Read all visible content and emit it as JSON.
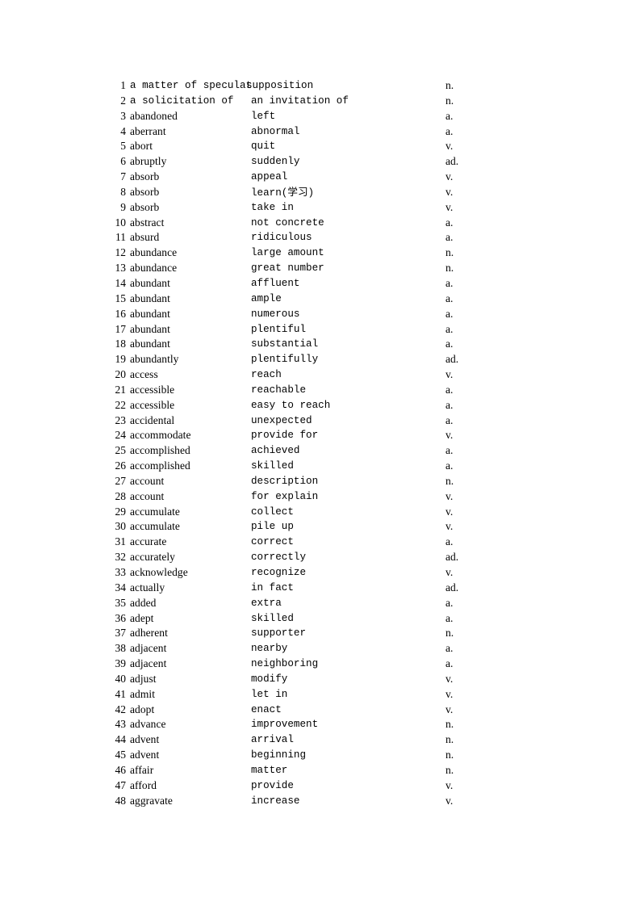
{
  "document": {
    "type": "vocabulary-synonym-list",
    "page_background": "#ffffff",
    "text_color": "#000000",
    "columns": {
      "index_header": "",
      "term_header": "",
      "definition_header": "",
      "pos_header": ""
    }
  },
  "rows": [
    {
      "index": "1",
      "term": "a matter of speculat",
      "definition": "supposition",
      "pos": "n.",
      "mono_term": false,
      "clipped": true
    },
    {
      "index": "2",
      "term": "a solicitation of",
      "definition": "an invitation of",
      "pos": "n.",
      "mono_term": true,
      "clipped": false
    },
    {
      "index": "3",
      "term": "abandoned",
      "definition": "left",
      "pos": "a.",
      "mono_term": false,
      "clipped": false
    },
    {
      "index": "4",
      "term": "aberrant",
      "definition": "abnormal",
      "pos": "a.",
      "mono_term": false,
      "clipped": false
    },
    {
      "index": "5",
      "term": "abort",
      "definition": "quit",
      "pos": "v.",
      "mono_term": false,
      "clipped": false
    },
    {
      "index": "6",
      "term": "abruptly",
      "definition": "suddenly",
      "pos": "ad.",
      "mono_term": false,
      "clipped": false
    },
    {
      "index": "7",
      "term": "absorb",
      "definition": "appeal",
      "pos": "v.",
      "mono_term": false,
      "clipped": false
    },
    {
      "index": "8",
      "term": "absorb",
      "definition": "learn(学习)",
      "pos": "v.",
      "mono_term": false,
      "clipped": false
    },
    {
      "index": "9",
      "term": "absorb",
      "definition": "take in",
      "pos": "v.",
      "mono_term": false,
      "clipped": false
    },
    {
      "index": "10",
      "term": "abstract",
      "definition": "not concrete",
      "pos": "a.",
      "mono_term": false,
      "clipped": false
    },
    {
      "index": "11",
      "term": "absurd",
      "definition": "ridiculous",
      "pos": "a.",
      "mono_term": false,
      "clipped": false
    },
    {
      "index": "12",
      "term": "abundance",
      "definition": "large amount",
      "pos": "n.",
      "mono_term": false,
      "clipped": false
    },
    {
      "index": "13",
      "term": "abundance",
      "definition": "great number",
      "pos": "n.",
      "mono_term": false,
      "clipped": false
    },
    {
      "index": "14",
      "term": "abundant",
      "definition": "affluent",
      "pos": "a.",
      "mono_term": false,
      "clipped": false
    },
    {
      "index": "15",
      "term": "abundant",
      "definition": "ample",
      "pos": "a.",
      "mono_term": false,
      "clipped": false
    },
    {
      "index": "16",
      "term": "abundant",
      "definition": "numerous",
      "pos": "a.",
      "mono_term": false,
      "clipped": false
    },
    {
      "index": "17",
      "term": "abundant",
      "definition": "plentiful",
      "pos": "a.",
      "mono_term": false,
      "clipped": false
    },
    {
      "index": "18",
      "term": "abundant",
      "definition": "substantial",
      "pos": "a.",
      "mono_term": false,
      "clipped": false
    },
    {
      "index": "19",
      "term": "abundantly",
      "definition": "plentifully",
      "pos": "ad.",
      "mono_term": false,
      "clipped": false
    },
    {
      "index": "20",
      "term": "access",
      "definition": "reach",
      "pos": "v.",
      "mono_term": false,
      "clipped": false
    },
    {
      "index": "21",
      "term": "accessible",
      "definition": "reachable",
      "pos": "a.",
      "mono_term": false,
      "clipped": false
    },
    {
      "index": "22",
      "term": "accessible",
      "definition": "easy to reach",
      "pos": "a.",
      "mono_term": false,
      "clipped": false
    },
    {
      "index": "23",
      "term": "accidental",
      "definition": "unexpected",
      "pos": "a.",
      "mono_term": false,
      "clipped": false
    },
    {
      "index": "24",
      "term": "accommodate",
      "definition": "provide for",
      "pos": "v.",
      "mono_term": false,
      "clipped": false
    },
    {
      "index": "25",
      "term": "accomplished",
      "definition": "achieved",
      "pos": "a.",
      "mono_term": false,
      "clipped": false
    },
    {
      "index": "26",
      "term": "accomplished",
      "definition": "skilled",
      "pos": "a.",
      "mono_term": false,
      "clipped": false
    },
    {
      "index": "27",
      "term": "account",
      "definition": "description",
      "pos": "n.",
      "mono_term": false,
      "clipped": false
    },
    {
      "index": "28",
      "term": "account",
      "definition": "for explain",
      "pos": "v.",
      "mono_term": false,
      "clipped": false
    },
    {
      "index": "29",
      "term": "accumulate",
      "definition": "collect",
      "pos": "v.",
      "mono_term": false,
      "clipped": false
    },
    {
      "index": "30",
      "term": "accumulate",
      "definition": "pile up",
      "pos": "v.",
      "mono_term": false,
      "clipped": false
    },
    {
      "index": "31",
      "term": "accurate",
      "definition": "correct",
      "pos": "a.",
      "mono_term": false,
      "clipped": false
    },
    {
      "index": "32",
      "term": "accurately",
      "definition": "correctly",
      "pos": "ad.",
      "mono_term": false,
      "clipped": false
    },
    {
      "index": "33",
      "term": "acknowledge",
      "definition": "recognize",
      "pos": "v.",
      "mono_term": false,
      "clipped": false
    },
    {
      "index": "34",
      "term": "actually",
      "definition": "in fact",
      "pos": "ad.",
      "mono_term": false,
      "clipped": false
    },
    {
      "index": "35",
      "term": "added",
      "definition": "extra",
      "pos": "a.",
      "mono_term": false,
      "clipped": false
    },
    {
      "index": "36",
      "term": "adept",
      "definition": "skilled",
      "pos": "a.",
      "mono_term": false,
      "clipped": false
    },
    {
      "index": "37",
      "term": "adherent",
      "definition": "supporter",
      "pos": "n.",
      "mono_term": false,
      "clipped": false
    },
    {
      "index": "38",
      "term": "adjacent",
      "definition": "nearby",
      "pos": "a.",
      "mono_term": false,
      "clipped": false
    },
    {
      "index": "39",
      "term": "adjacent",
      "definition": "neighboring",
      "pos": "a.",
      "mono_term": false,
      "clipped": false
    },
    {
      "index": "40",
      "term": "adjust",
      "definition": "modify",
      "pos": "v.",
      "mono_term": false,
      "clipped": false
    },
    {
      "index": "41",
      "term": "admit",
      "definition": "let in",
      "pos": "v.",
      "mono_term": false,
      "clipped": false
    },
    {
      "index": "42",
      "term": "adopt",
      "definition": "enact",
      "pos": "v.",
      "mono_term": false,
      "clipped": false
    },
    {
      "index": "43",
      "term": "advance",
      "definition": "improvement",
      "pos": "n.",
      "mono_term": false,
      "clipped": false
    },
    {
      "index": "44",
      "term": "advent",
      "definition": "arrival",
      "pos": "n.",
      "mono_term": false,
      "clipped": false
    },
    {
      "index": "45",
      "term": "advent",
      "definition": "beginning",
      "pos": "n.",
      "mono_term": false,
      "clipped": false
    },
    {
      "index": "46",
      "term": "affair",
      "definition": "matter",
      "pos": "n.",
      "mono_term": false,
      "clipped": false
    },
    {
      "index": "47",
      "term": "afford",
      "definition": "provide",
      "pos": "v.",
      "mono_term": false,
      "clipped": false
    },
    {
      "index": "48",
      "term": "aggravate",
      "definition": "increase",
      "pos": "v.",
      "mono_term": false,
      "clipped": false
    }
  ]
}
